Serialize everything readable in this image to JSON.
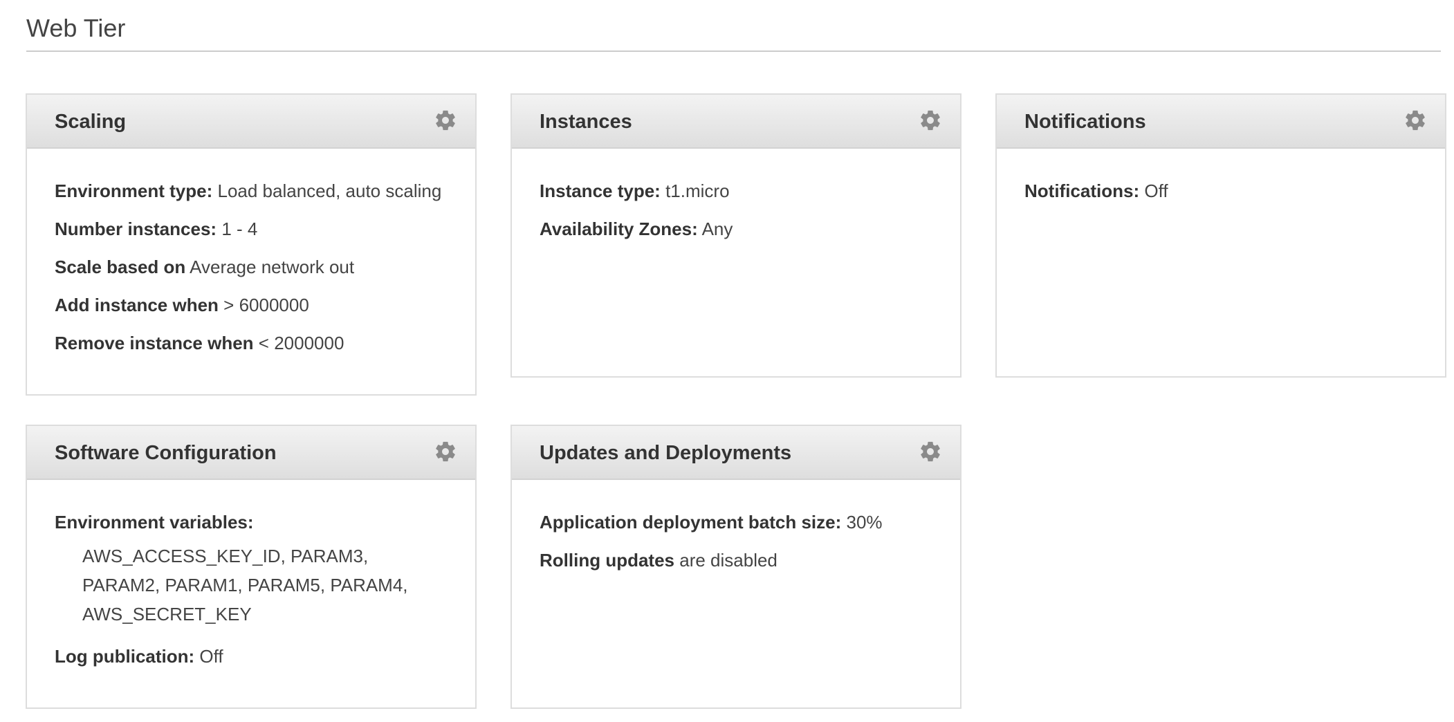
{
  "section": {
    "title": "Web Tier"
  },
  "icons": {
    "settings": "gear-icon"
  },
  "colors": {
    "header_gradient_top": "#f3f3f3",
    "header_gradient_bottom": "#dedede",
    "panel_border": "#dddddd",
    "gear": "#8a8a8a"
  },
  "panels": {
    "scaling": {
      "title": "Scaling",
      "rows": [
        {
          "label": "Environment type:",
          "value": "Load balanced, auto scaling"
        },
        {
          "label": "Number instances:",
          "value": "1 - 4"
        },
        {
          "label": "Scale based on",
          "value": "Average network out"
        },
        {
          "label": "Add instance when",
          "value": "> 6000000"
        },
        {
          "label": "Remove instance when",
          "value": "< 2000000"
        }
      ]
    },
    "instances": {
      "title": "Instances",
      "rows": [
        {
          "label": "Instance type:",
          "value": "t1.micro"
        },
        {
          "label": "Availability Zones:",
          "value": "Any"
        }
      ]
    },
    "notifications": {
      "title": "Notifications",
      "rows": [
        {
          "label": "Notifications:",
          "value": "Off"
        }
      ]
    },
    "software": {
      "title": "Software Configuration",
      "env_label": "Environment variables:",
      "env_values": "AWS_ACCESS_KEY_ID, PARAM3, PARAM2, PARAM1, PARAM5, PARAM4, AWS_SECRET_KEY",
      "rows": [
        {
          "label": "Log publication:",
          "value": "Off"
        }
      ]
    },
    "updates": {
      "title": "Updates and Deployments",
      "rows": [
        {
          "label": "Application deployment batch size:",
          "value": "30%"
        },
        {
          "label": "Rolling updates",
          "value": "are disabled"
        }
      ]
    }
  }
}
